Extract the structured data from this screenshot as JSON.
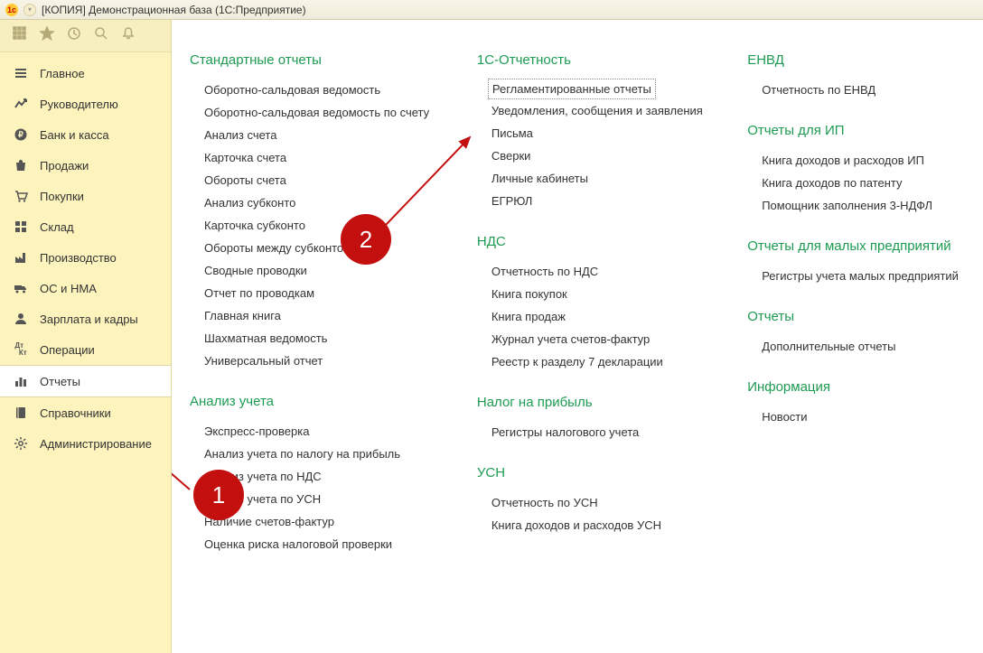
{
  "window": {
    "title": "[КОПИЯ] Демонстрационная база  (1С:Предприятие)"
  },
  "sidebar": {
    "items": [
      {
        "label": "Главное",
        "icon": "menu"
      },
      {
        "label": "Руководителю",
        "icon": "chart"
      },
      {
        "label": "Банк и касса",
        "icon": "ruble"
      },
      {
        "label": "Продажи",
        "icon": "bag"
      },
      {
        "label": "Покупки",
        "icon": "cart"
      },
      {
        "label": "Склад",
        "icon": "boxes"
      },
      {
        "label": "Производство",
        "icon": "factory"
      },
      {
        "label": "ОС и НМА",
        "icon": "truck"
      },
      {
        "label": "Зарплата и кадры",
        "icon": "user"
      },
      {
        "label": "Операции",
        "icon": "dtkt"
      },
      {
        "label": "Отчеты",
        "icon": "bars",
        "active": true
      },
      {
        "label": "Справочники",
        "icon": "book"
      },
      {
        "label": "Администрирование",
        "icon": "gear"
      }
    ]
  },
  "content": {
    "col1": [
      {
        "title": "Стандартные отчеты",
        "items": [
          "Оборотно-сальдовая ведомость",
          "Оборотно-сальдовая ведомость по счету",
          "Анализ счета",
          "Карточка счета",
          "Обороты счета",
          "Анализ субконто",
          "Карточка субконто",
          "Обороты между субконто",
          "Сводные проводки",
          "Отчет по проводкам",
          "Главная книга",
          "Шахматная ведомость",
          "Универсальный отчет"
        ]
      },
      {
        "title": "Анализ учета",
        "items": [
          "Экспресс-проверка",
          "Анализ учета по налогу на прибыль",
          "Анализ учета по НДС",
          "Анализ учета по УСН",
          "Наличие счетов-фактур",
          "Оценка риска налоговой проверки"
        ]
      }
    ],
    "col2": [
      {
        "title": "1С-Отчетность",
        "items": [
          "Регламентированные отчеты",
          "Уведомления, сообщения и заявления",
          "Письма",
          "Сверки",
          "Личные кабинеты",
          "ЕГРЮЛ"
        ]
      },
      {
        "title": "НДС",
        "items": [
          "Отчетность по НДС",
          "Книга покупок",
          "Книга продаж",
          "Журнал учета счетов-фактур",
          "Реестр к разделу 7 декларации"
        ]
      },
      {
        "title": "Налог на прибыль",
        "items": [
          "Регистры налогового учета"
        ]
      },
      {
        "title": "УСН",
        "items": [
          "Отчетность по УСН",
          "Книга доходов и расходов УСН"
        ]
      }
    ],
    "col3": [
      {
        "title": "ЕНВД",
        "items": [
          "Отчетность по ЕНВД"
        ]
      },
      {
        "title": "Отчеты для ИП",
        "items": [
          "Книга доходов и расходов ИП",
          "Книга доходов по патенту",
          "Помощник заполнения 3-НДФЛ"
        ]
      },
      {
        "title": "Отчеты для малых предприятий",
        "items": [
          "Регистры учета малых предприятий"
        ]
      },
      {
        "title": "Отчеты",
        "items": [
          "Дополнительные отчеты"
        ]
      },
      {
        "title": "Информация",
        "items": [
          "Новости"
        ]
      }
    ]
  },
  "annotations": {
    "badge1": "1",
    "badge2": "2"
  }
}
